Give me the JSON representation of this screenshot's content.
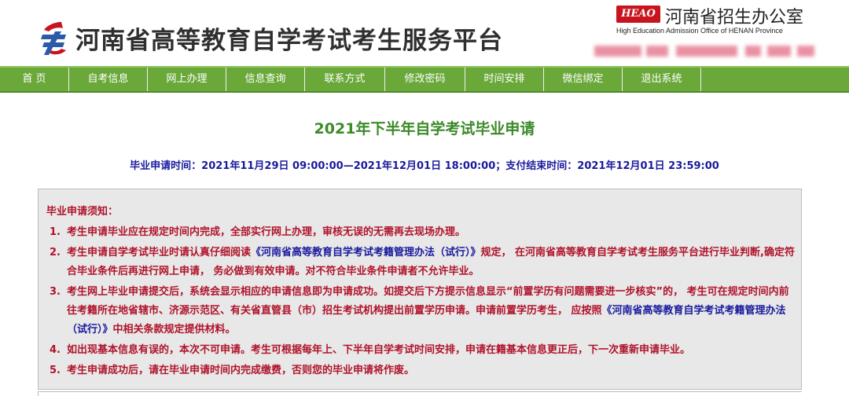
{
  "header": {
    "site_title": "河南省高等教育自学考试考生服务平台",
    "office_badge": "HEAO",
    "office_name": "河南省招生办公室",
    "office_en": "High Education Admission Office of HENAN Province"
  },
  "nav": {
    "items": [
      "首 页",
      "自考信息",
      "网上办理",
      "信息查询",
      "联系方式",
      "修改密码",
      "时间安排",
      "微信绑定",
      "退出系统"
    ]
  },
  "page": {
    "title": "2021年下半年自学考试毕业申请",
    "time_line": "毕业申请时间：2021年11月29日 09:00:00—2021年12月01日 18:00:00；支付结束时间：2021年12月01日 23:59:00"
  },
  "notice": {
    "title": "毕业申请须知：",
    "items": [
      {
        "num": "1.",
        "text": "考生申请毕业应在规定时间内完成，全部实行网上办理，审核无误的无需再去现场办理。"
      },
      {
        "num": "2.",
        "pre": "考生申请自学考试毕业时请认真仔细阅读",
        "link": "《河南省高等教育自学考试考籍管理办法（试行）》",
        "post": "规定， 在河南省高等教育自学考试考生服务平台进行毕业判断,确定符合毕业条件后再进行网上申请， 务必做到有效申请。对不符合毕业条件申请者不允许毕业。"
      },
      {
        "num": "3.",
        "pre": "考生网上毕业申请提交后，系统会显示相应的申请信息即为申请成功。如提交后下方提示信息显示“前置学历有问题需要进一步核实”的， 考生可在规定时间内前往考籍所在地省辖市、济源示范区、有关省直管县（市）招生考试机构提出前置学历申请。申请前置学历考生， 应按照",
        "link": "《河南省高等教育自学考试考籍管理办法（试行）》",
        "post": "中相关条款规定提供材料。"
      },
      {
        "num": "4.",
        "text": "如出现基本信息有误的，本次不可申请。考生可根据每年上、下半年自学考试时间安排，申请在籍基本信息更正后，下一次重新申请毕业。"
      },
      {
        "num": "5.",
        "text": "考生申请成功后，请在毕业申请时间内完成缴费，否则您的毕业申请将作废。"
      }
    ]
  },
  "colors": {
    "nav_bg": "#6aa839",
    "title_green": "#3c8a2a",
    "time_blue": "#1a1a9e",
    "notice_red": "#b0132a",
    "notice_bg": "#e8e8e8"
  }
}
